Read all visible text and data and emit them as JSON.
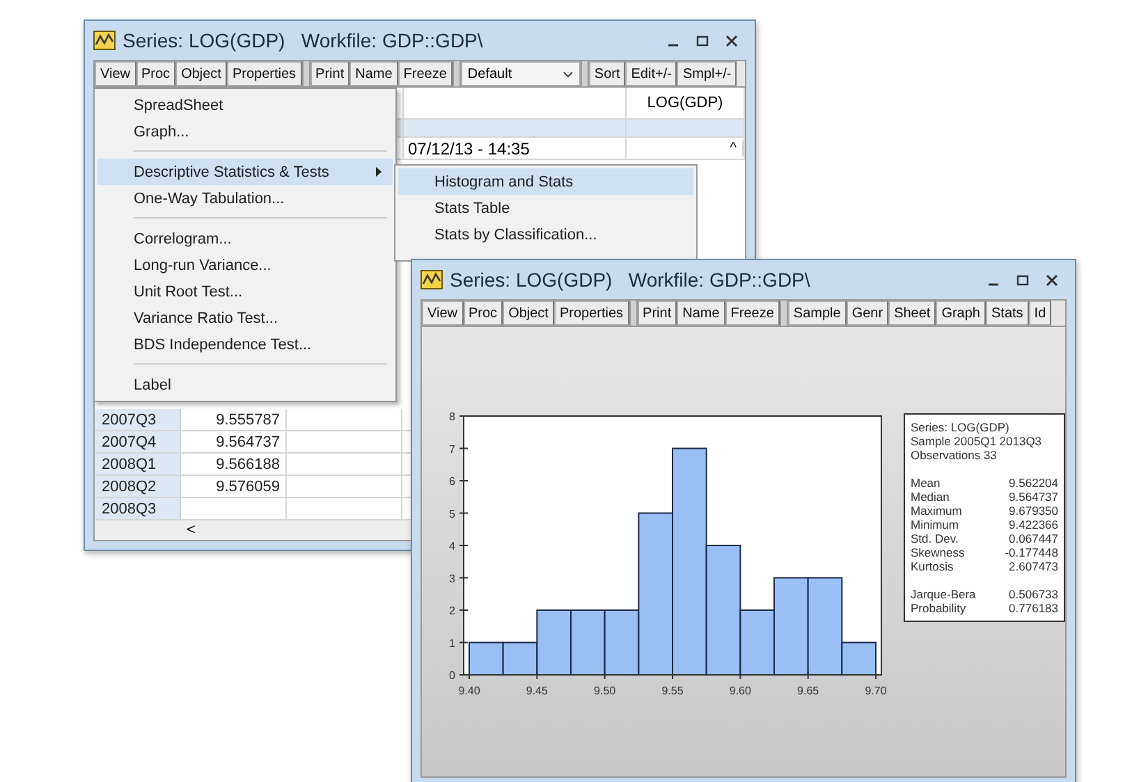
{
  "back_window": {
    "title": "Series: LOG(GDP)   Workfile: GDP::GDP\\",
    "toolbar": [
      [
        {
          "label": "View"
        },
        {
          "label": "Proc"
        },
        {
          "label": "Object"
        },
        {
          "label": "Properties"
        }
      ],
      [
        {
          "label": "Print"
        },
        {
          "label": "Name"
        },
        {
          "label": "Freeze"
        }
      ]
    ],
    "dropdown": {
      "value": "Default"
    },
    "toolbar_right": [
      {
        "label": "Sort"
      },
      {
        "label": "Edit+/-"
      },
      {
        "label": "Smpl+/-"
      }
    ],
    "column_header": "LOG(GDP)",
    "timestamp": "07/12/13 - 14:35",
    "rows": [
      {
        "label": "2007Q3",
        "value": "9.555787"
      },
      {
        "label": "2007Q4",
        "value": "9.564737"
      },
      {
        "label": "2008Q1",
        "value": "9.566188"
      },
      {
        "label": "2008Q2",
        "value": "9.576059"
      },
      {
        "label": "2008Q3"
      }
    ],
    "scroll_left": "<",
    "scroll_up": "^"
  },
  "view_menu": {
    "items": [
      {
        "kind": "item",
        "label": "SpreadSheet",
        "selected": false,
        "submenu": false
      },
      {
        "kind": "item",
        "label": "Graph...",
        "selected": false,
        "submenu": false
      },
      {
        "kind": "separator"
      },
      {
        "kind": "item",
        "label": "Descriptive Statistics & Tests",
        "selected": true,
        "submenu": true
      },
      {
        "kind": "item",
        "label": "One-Way Tabulation...",
        "selected": false,
        "submenu": false
      },
      {
        "kind": "separator"
      },
      {
        "kind": "item",
        "label": "Correlogram...",
        "selected": false,
        "submenu": false
      },
      {
        "kind": "item",
        "label": "Long-run Variance...",
        "selected": false,
        "submenu": false
      },
      {
        "kind": "item",
        "label": "Unit Root Test...",
        "selected": false,
        "submenu": false
      },
      {
        "kind": "item",
        "label": "Variance Ratio Test...",
        "selected": false,
        "submenu": false
      },
      {
        "kind": "item",
        "label": "BDS Independence Test...",
        "selected": false,
        "submenu": false
      },
      {
        "kind": "separator"
      },
      {
        "kind": "item",
        "label": "Label",
        "selected": false,
        "submenu": false
      }
    ]
  },
  "submenu": {
    "items": [
      {
        "label": "Histogram and Stats",
        "selected": true
      },
      {
        "label": "Stats Table",
        "selected": false
      },
      {
        "label": "Stats by Classification...",
        "selected": false
      }
    ]
  },
  "front_window": {
    "title": "Series: LOG(GDP)   Workfile: GDP::GDP\\",
    "toolbar": [
      [
        {
          "label": "View"
        },
        {
          "label": "Proc"
        },
        {
          "label": "Object"
        },
        {
          "label": "Properties"
        }
      ],
      [
        {
          "label": "Print"
        },
        {
          "label": "Name"
        },
        {
          "label": "Freeze"
        }
      ],
      [
        {
          "label": "Sample"
        },
        {
          "label": "Genr"
        },
        {
          "label": "Sheet"
        },
        {
          "label": "Graph"
        },
        {
          "label": "Stats"
        },
        {
          "label": "Id"
        }
      ]
    ],
    "chart_data": {
      "type": "bar",
      "x": [
        9.4125,
        9.4375,
        9.4625,
        9.4875,
        9.5125,
        9.5375,
        9.5625,
        9.5875,
        9.6125,
        9.6375,
        9.6625,
        9.6875
      ],
      "series": [
        {
          "color": "#99bff5",
          "values": [
            1,
            1,
            2,
            2,
            2,
            5,
            7,
            4,
            2,
            3,
            3,
            1
          ]
        }
      ],
      "xlim": [
        9.4,
        9.7
      ],
      "ylim": [
        0,
        8
      ],
      "xticks": [
        {
          "value": 9.4,
          "label": "9.40"
        },
        {
          "value": 9.45,
          "label": "9.45"
        },
        {
          "value": 9.5,
          "label": "9.50"
        },
        {
          "value": 9.55,
          "label": "9.55"
        },
        {
          "value": 9.6,
          "label": "9.60"
        },
        {
          "value": 9.65,
          "label": "9.65"
        },
        {
          "value": 9.7,
          "label": "9.70"
        }
      ],
      "yticks": [
        0,
        1,
        2,
        3,
        4,
        5,
        6,
        7,
        8
      ]
    },
    "stats": {
      "header": [
        "Series: LOG(GDP)",
        "Sample 2005Q1 2013Q3",
        "Observations 33"
      ],
      "rows": [
        {
          "label": "Mean",
          "value": "9.562204"
        },
        {
          "label": "Median",
          "value": "9.564737"
        },
        {
          "label": "Maximum",
          "value": "9.679350"
        },
        {
          "label": "Minimum",
          "value": "9.422366"
        },
        {
          "label": "Std. Dev.",
          "value": "0.067447"
        },
        {
          "label": "Skewness",
          "value": "-0.177448"
        },
        {
          "label": "Kurtosis",
          "value": "2.607473"
        }
      ],
      "tests": [
        {
          "label": "Jarque-Bera",
          "value": "0.506733"
        },
        {
          "label": "Probability",
          "value": "0.776183"
        }
      ]
    }
  }
}
